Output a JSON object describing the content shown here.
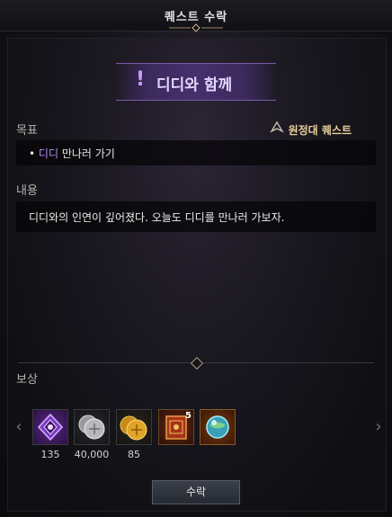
{
  "window": {
    "title": "퀘스트 수락"
  },
  "quest": {
    "name": "디디와 함께",
    "type_label": "원정대 퀘스트"
  },
  "objective": {
    "heading": "목표",
    "bullet": "•",
    "highlight": "디디",
    "text": " 만나러 가기"
  },
  "content": {
    "heading": "내용",
    "text": "디디와의 인연이 깊어졌다. 오늘도 디디를 만나러 가보자."
  },
  "rewards": {
    "heading": "보상",
    "items": [
      {
        "icon": "purple-crystal-icon",
        "amount": "135"
      },
      {
        "icon": "silver-coin-icon",
        "amount": "40,000"
      },
      {
        "icon": "gold-coin-icon",
        "amount": "85"
      },
      {
        "icon": "red-book-icon",
        "stack": "5"
      },
      {
        "icon": "blue-orb-icon"
      }
    ]
  },
  "buttons": {
    "accept": "수락",
    "prev": "‹",
    "next": "›"
  },
  "colors": {
    "accent_purple": "#b78bf0",
    "gold": "#e9cf9b",
    "banner": "#46306c"
  }
}
